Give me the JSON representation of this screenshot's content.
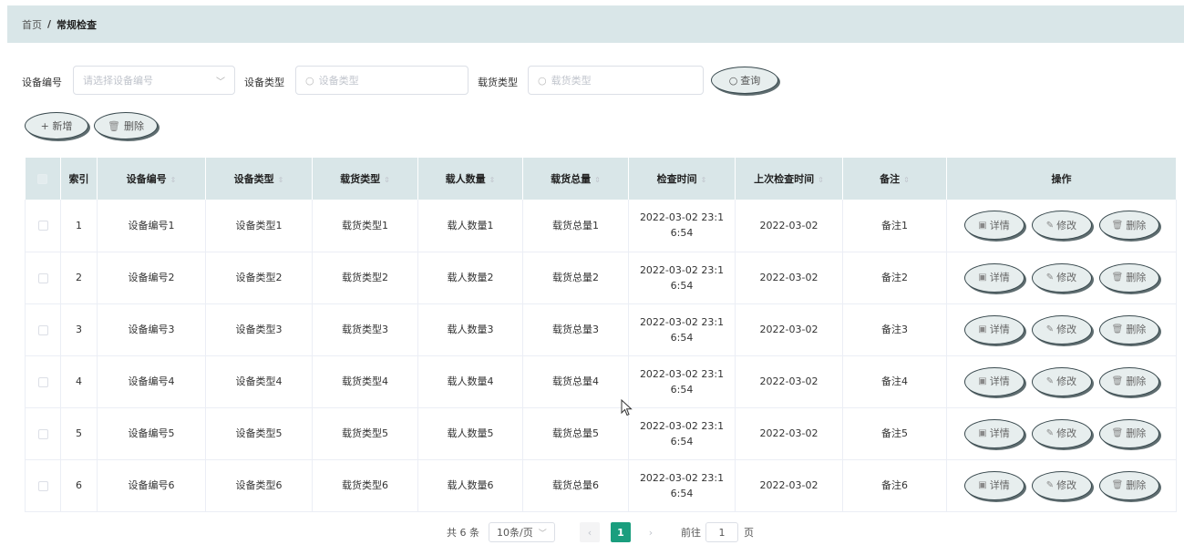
{
  "breadcrumb": {
    "home": "首页",
    "separator": "/",
    "current": "常规检查"
  },
  "filters": {
    "device_no_label": "设备编号",
    "device_no_placeholder": "请选择设备编号",
    "device_type_label": "设备类型",
    "device_type_placeholder": "设备类型",
    "cargo_type_label": "载货类型",
    "cargo_type_placeholder": "载货类型",
    "search_label": "查询"
  },
  "actions": {
    "add_label": "+ 新增",
    "delete_label": "删除"
  },
  "table": {
    "headers": [
      "索引",
      "设备编号",
      "设备类型",
      "载货类型",
      "载人数量",
      "载货总量",
      "检查时间",
      "上次检查时间",
      "备注",
      "操作"
    ],
    "rows": [
      {
        "index": "1",
        "device_no": "设备编号1",
        "device_type": "设备类型1",
        "cargo_type": "载货类型1",
        "passengers": "载人数量1",
        "cargo_total": "载货总量1",
        "check_time": "2022-03-02 23:1 6:54",
        "last_check": "2022-03-02",
        "note": "备注1"
      },
      {
        "index": "2",
        "device_no": "设备编号2",
        "device_type": "设备类型2",
        "cargo_type": "载货类型2",
        "passengers": "载人数量2",
        "cargo_total": "载货总量2",
        "check_time": "2022-03-02 23:1 6:54",
        "last_check": "2022-03-02",
        "note": "备注2"
      },
      {
        "index": "3",
        "device_no": "设备编号3",
        "device_type": "设备类型3",
        "cargo_type": "载货类型3",
        "passengers": "载人数量3",
        "cargo_total": "载货总量3",
        "check_time": "2022-03-02 23:1 6:54",
        "last_check": "2022-03-02",
        "note": "备注3"
      },
      {
        "index": "4",
        "device_no": "设备编号4",
        "device_type": "设备类型4",
        "cargo_type": "载货类型4",
        "passengers": "载人数量4",
        "cargo_total": "载货总量4",
        "check_time": "2022-03-02 23:1 6:54",
        "last_check": "2022-03-02",
        "note": "备注4"
      },
      {
        "index": "5",
        "device_no": "设备编号5",
        "device_type": "设备类型5",
        "cargo_type": "载货类型5",
        "passengers": "载人数量5",
        "cargo_total": "载货总量5",
        "check_time": "2022-03-02 23:1 6:54",
        "last_check": "2022-03-02",
        "note": "备注5"
      },
      {
        "index": "6",
        "device_no": "设备编号6",
        "device_type": "设备类型6",
        "cargo_type": "载货类型6",
        "passengers": "载人数量6",
        "cargo_total": "载货总量6",
        "check_time": "2022-03-02 23:1 6:54",
        "last_check": "2022-03-02",
        "note": "备注6"
      }
    ],
    "row_actions": {
      "detail": "详情",
      "edit": "修改",
      "delete": "删除"
    }
  },
  "pagination": {
    "total": "共 6 条",
    "page_size": "10条/页",
    "current_page": "1",
    "goto_label": "前往",
    "goto_value": "1",
    "page_suffix": "页"
  },
  "colors": {
    "header_bg": "#d9e6e8",
    "accent": "#1a9e7e"
  },
  "icons": {
    "search": "search-icon",
    "add": "plus-icon",
    "delete": "trash-icon",
    "detail": "document-icon",
    "edit": "pencil-icon"
  }
}
